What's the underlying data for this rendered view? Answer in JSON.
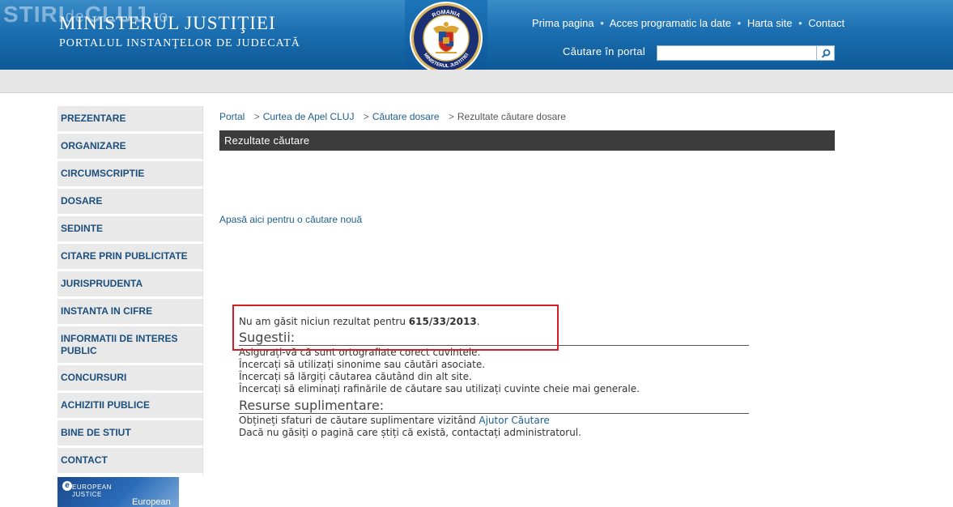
{
  "watermark": {
    "main": "STIRI",
    "small": "de",
    "end": "CLUJ",
    "suffix": ".ro"
  },
  "header": {
    "title": "MINISTERUL JUSTIŢIEI",
    "subtitle": "PORTALUL INSTANŢELOR DE JUDECATĂ",
    "emblem_top_text": "ROMANIA",
    "emblem_bottom_text": "MINISTERUL JUSTITIEI",
    "nav": {
      "home": "Prima pagina",
      "programmatic": "Acces programatic la date",
      "sitemap": "Harta site",
      "contact": "Contact",
      "separator": "•"
    },
    "search": {
      "label": "Căutare în portal",
      "value": ""
    }
  },
  "sidebar": {
    "items": [
      {
        "label": "PREZENTARE"
      },
      {
        "label": "ORGANIZARE"
      },
      {
        "label": "CIRCUMSCRIPTIE"
      },
      {
        "label": "DOSARE"
      },
      {
        "label": "SEDINTE"
      },
      {
        "label": "CITARE PRIN PUBLICITATE"
      },
      {
        "label": "JURISPRUDENTA"
      },
      {
        "label": "INSTANTA IN CIFRE"
      },
      {
        "label": "INFORMATII DE INTERES PUBLIC"
      },
      {
        "label": "CONCURSURI"
      },
      {
        "label": "ACHIZITII PUBLICE"
      },
      {
        "label": "BINE DE STIUT"
      },
      {
        "label": "CONTACT"
      }
    ],
    "banner": {
      "line1": "EUROPEAN",
      "line2": "JUSTICE",
      "bottom": "European",
      "letter": "e"
    }
  },
  "breadcrumb": {
    "items": [
      "Portal",
      "Curtea de Apel CLUJ",
      "Căutare dosare"
    ],
    "current": "Rezultate căutare dosare",
    "separator": ">"
  },
  "results": {
    "bar_title": "Rezultate căutare",
    "new_search_link": "Apasă aici pentru o căutare nouă",
    "no_result_prefix": "Nu am găsit niciun rezultat pentru",
    "query": "615/33/2013",
    "no_result_suffix": ".",
    "suggestions_title": "Sugestii:",
    "suggestions": [
      "Asigurați-vă că sunt ortografiate corect cuvintele.",
      "Încercați să utilizați sinonime sau căutări asociate.",
      "Încercați să lărgiți căutarea căutând din alt site.",
      "Încercați să eliminați rafinările de căutare sau utilizați cuvinte cheie mai generale."
    ],
    "resources_title": "Resurse suplimentare:",
    "resources_line1_prefix": "Obțineți sfaturi de căutare suplimentare vizitând",
    "resources_line1_link": "Ajutor Căutare",
    "resources_line2": "Dacă nu găsiți o pagină care știți că există, contactați administratorul."
  },
  "colors": {
    "header_blue": "#1a6eb0",
    "link_blue": "#1d5f8c",
    "menu_bg": "#e9e9e9",
    "results_bar": "#3c3c3c",
    "highlight_red": "#d42020"
  }
}
